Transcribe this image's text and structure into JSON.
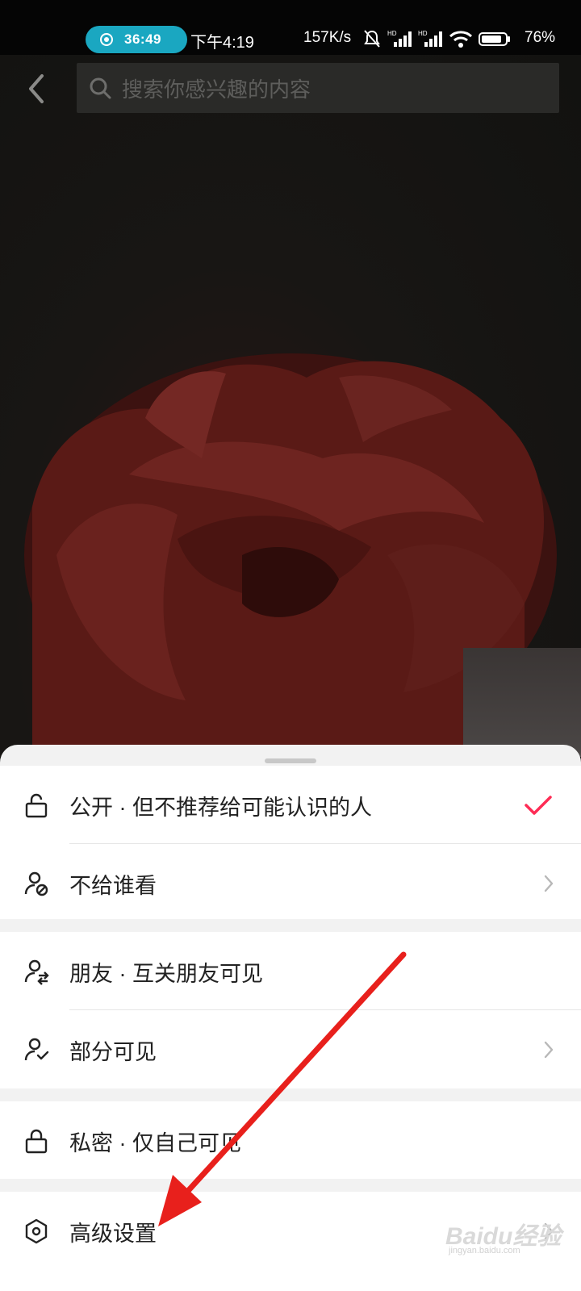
{
  "status_bar": {
    "recording_time": "36:49",
    "clock": "下午4:19",
    "net_speed": "157K/s",
    "battery_percent": "76%"
  },
  "header": {
    "search_placeholder": "搜索你感兴趣的内容"
  },
  "privacy_sheet": {
    "options": [
      {
        "label": "公开 · 但不推荐给可能认识的人",
        "icon": "unlock-icon",
        "selected": true
      },
      {
        "label": "不给谁看",
        "icon": "user-block-icon",
        "has_chevron": true
      },
      {
        "label": "朋友 · 互关朋友可见",
        "icon": "mutual-friends-icon"
      },
      {
        "label": "部分可见",
        "icon": "user-check-icon",
        "has_chevron": true
      },
      {
        "label": "私密 · 仅自己可见",
        "icon": "lock-icon"
      },
      {
        "label": "高级设置",
        "icon": "hexagon-settings-icon",
        "has_chevron": true
      }
    ],
    "accent_color": "#fe2c55"
  },
  "watermark": {
    "logo_text": "Baidu经验",
    "sub_text": "jingyan.baidu.com"
  }
}
